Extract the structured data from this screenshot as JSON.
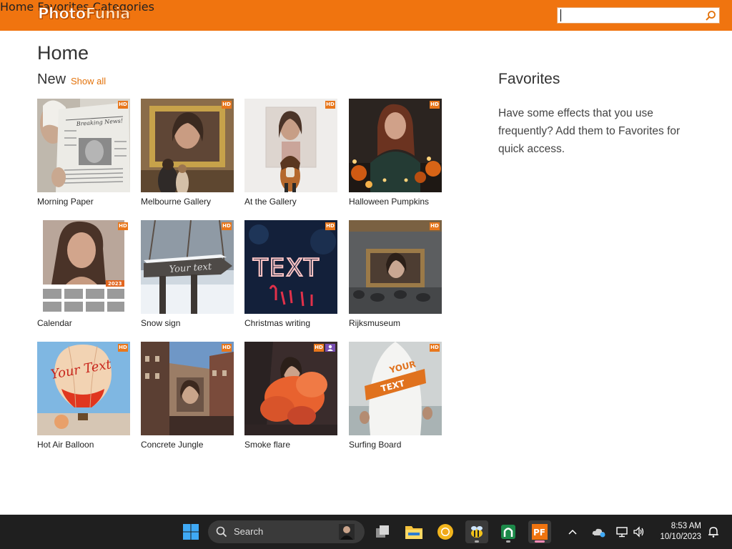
{
  "header": {
    "logo_photo": "Photo",
    "logo_funia": "Funia",
    "nav": [
      "Home",
      "Favorites",
      "Categories"
    ],
    "search_value": "",
    "brand_color": "#f0740f"
  },
  "main": {
    "title": "Home",
    "section_title": "New",
    "show_all": "Show all",
    "hd_badge": "HD",
    "tiles": [
      {
        "label": "Morning Paper",
        "hd": true
      },
      {
        "label": "Melbourne Gallery",
        "hd": true
      },
      {
        "label": "At the Gallery",
        "hd": true
      },
      {
        "label": "Halloween Pumpkins",
        "hd": true
      },
      {
        "label": "Calendar",
        "hd": true,
        "overlay_text": "2023"
      },
      {
        "label": "Snow sign",
        "hd": true,
        "overlay_text": "Your text"
      },
      {
        "label": "Christmas writing",
        "hd": true,
        "overlay_text": "TEXT"
      },
      {
        "label": "Rijksmuseum",
        "hd": true
      },
      {
        "label": "Hot Air Balloon",
        "hd": true,
        "overlay_text": "Your Text"
      },
      {
        "label": "Concrete Jungle",
        "hd": true
      },
      {
        "label": "Smoke flare",
        "hd": true,
        "person_badge": true
      },
      {
        "label": "Surfing Board",
        "hd": true,
        "overlay_text_1": "YOUR",
        "overlay_text_2": "TEXT"
      }
    ]
  },
  "favorites": {
    "title": "Favorites",
    "text": "Have some effects that you use frequently? Add them to Favorites for quick access."
  },
  "taskbar": {
    "search_label": "Search",
    "time": "8:53 AM",
    "date": "10/10/2023",
    "icons": [
      "windows-start-icon",
      "search-icon",
      "task-view-icon",
      "file-explorer-icon",
      "chrome-canary-icon",
      "bee-app-icon",
      "android-studio-icon",
      "photofunia-app-icon",
      "chevron-up-icon",
      "onedrive-icon",
      "network-icon",
      "volume-icon",
      "notification-icon"
    ]
  }
}
